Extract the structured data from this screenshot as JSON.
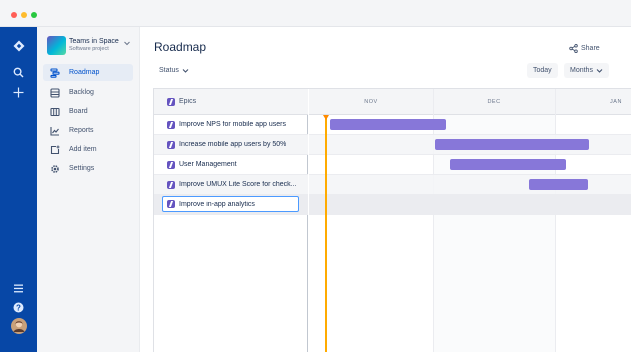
{
  "window": {
    "dot_colors": [
      "#ff5f57",
      "#febc2e",
      "#28c840"
    ]
  },
  "global_nav": {
    "background": "#0747a6",
    "top_icons": [
      "jira-logo-icon",
      "search-icon",
      "create-plus-icon"
    ],
    "bottom_icons": [
      "menu-icon",
      "help-icon",
      "user-avatar"
    ]
  },
  "sidebar": {
    "project_name": "Teams in Space",
    "project_type": "Software project",
    "items": [
      {
        "label": "Roadmap",
        "icon": "roadmap-icon",
        "active": true
      },
      {
        "label": "Backlog",
        "icon": "backlog-icon",
        "active": false
      },
      {
        "label": "Board",
        "icon": "board-icon",
        "active": false
      },
      {
        "label": "Reports",
        "icon": "reports-icon",
        "active": false
      },
      {
        "label": "Add item",
        "icon": "add-item-icon",
        "active": false
      },
      {
        "label": "Settings",
        "icon": "settings-icon",
        "active": false
      }
    ]
  },
  "header": {
    "title": "Roadmap",
    "share_label": "Share",
    "status_label": "Status",
    "today_label": "Today",
    "months_label": "Months"
  },
  "roadmap": {
    "epics_header": "Epics",
    "months": [
      "NOV",
      "DEC",
      "JAN"
    ],
    "epic_color": "#6554c0",
    "bar_color": "#8777d9",
    "today_color": "#ffab00",
    "epics": [
      {
        "name": "Improve NPS for mobile app users"
      },
      {
        "name": "Increase mobile app users by 50%"
      },
      {
        "name": "User Management"
      },
      {
        "name": "Improve UMUX Lite Score for check..."
      }
    ],
    "editing_value": "Improve in-app analytics"
  }
}
